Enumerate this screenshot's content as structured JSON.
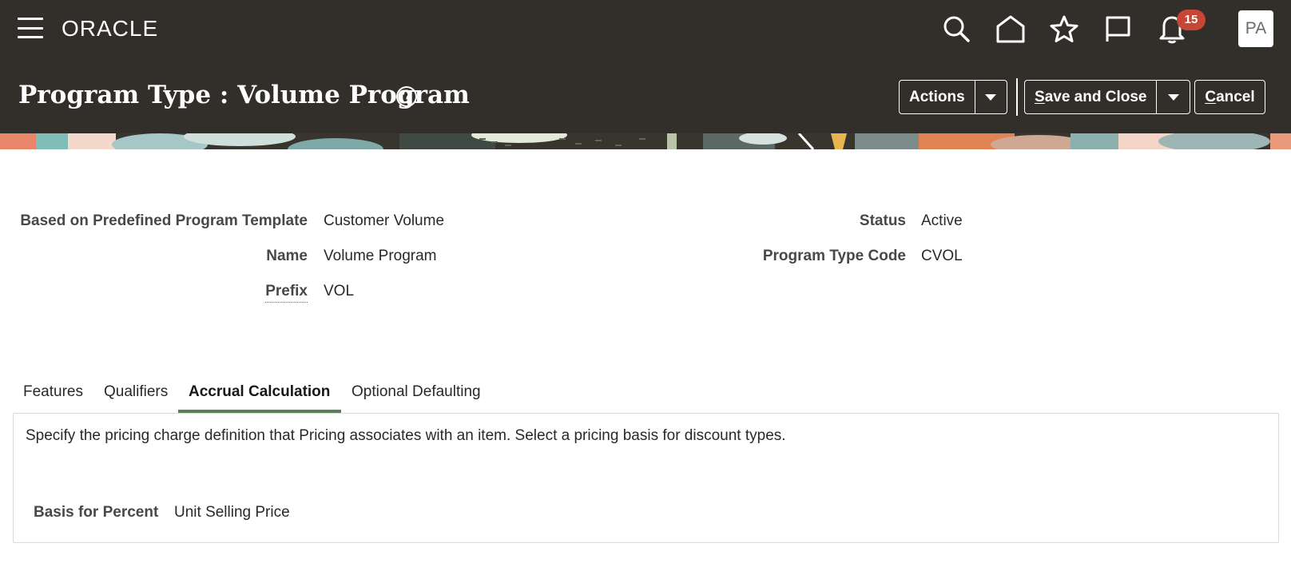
{
  "header": {
    "brand": "ORACLE",
    "notification_count": "15",
    "user_initials": "PA",
    "icons": [
      "menu-icon",
      "search-icon",
      "home-icon",
      "star-icon",
      "flag-icon",
      "bell-icon"
    ]
  },
  "page": {
    "title": "Program Type : Volume Program",
    "actions_label": "Actions",
    "save_close_label": {
      "first": "S",
      "rest": "ave and Close"
    },
    "cancel_label": {
      "first": "C",
      "rest": "ancel"
    }
  },
  "form": {
    "template_label": "Based on Predefined Program Template",
    "template_value": "Customer Volume",
    "name_label": "Name",
    "name_value": "Volume Program",
    "prefix_label": "Prefix",
    "prefix_value": "VOL",
    "status_label": "Status",
    "status_value": "Active",
    "code_label": "Program Type Code",
    "code_value": "CVOL"
  },
  "tabs": [
    {
      "label": "Features",
      "active": false
    },
    {
      "label": "Qualifiers",
      "active": false
    },
    {
      "label": "Accrual Calculation",
      "active": true
    },
    {
      "label": "Optional Defaulting",
      "active": false
    }
  ],
  "panel": {
    "description": "Specify the pricing charge definition that Pricing associates with an item. Select a pricing basis for discount types.",
    "basis_label": "Basis for Percent",
    "basis_value": "Unit Selling Price"
  },
  "colors": {
    "header_bg": "#322f2b",
    "badge": "#c74634",
    "tab_active_underline": "#5b7f5b"
  }
}
